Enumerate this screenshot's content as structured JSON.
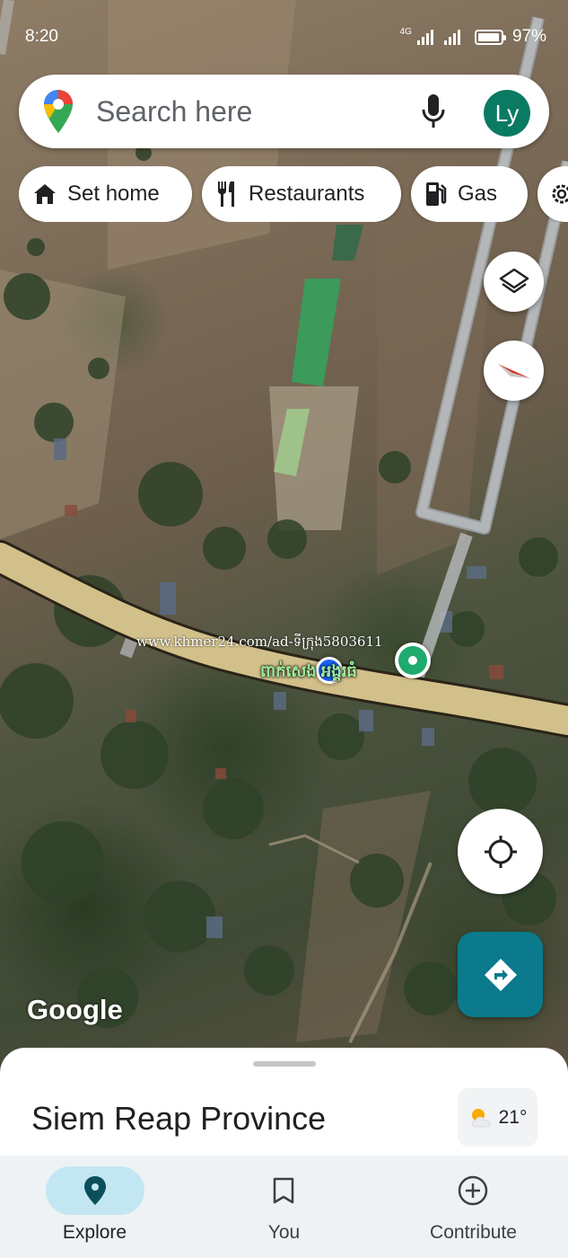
{
  "status_bar": {
    "time": "8:20",
    "network": "4G",
    "battery": "97%"
  },
  "search": {
    "placeholder": "Search here",
    "avatar_initials": "Ly"
  },
  "chips": [
    {
      "label": "Set home",
      "icon": "home-icon"
    },
    {
      "label": "Restaurants",
      "icon": "restaurant-icon"
    },
    {
      "label": "Gas",
      "icon": "gas-station-icon"
    }
  ],
  "map": {
    "watermark": "www.khmer24.com/ad-ទីក្រុង5803611",
    "place_label": "ពាក់សេង អង្គរធំ",
    "attribution": "Google"
  },
  "sheet": {
    "title": "Siem Reap Province",
    "weather_temp": "21°"
  },
  "bottom_nav": [
    {
      "label": "Explore",
      "icon": "explore-pin-icon",
      "active": true
    },
    {
      "label": "You",
      "icon": "bookmark-icon",
      "active": false
    },
    {
      "label": "Contribute",
      "icon": "add-circle-icon",
      "active": false
    }
  ],
  "colors": {
    "accent": "#0b7a8c",
    "avatar": "#0b7a63",
    "active_nav": "#c2e7f3",
    "road": "#d2c08a"
  }
}
